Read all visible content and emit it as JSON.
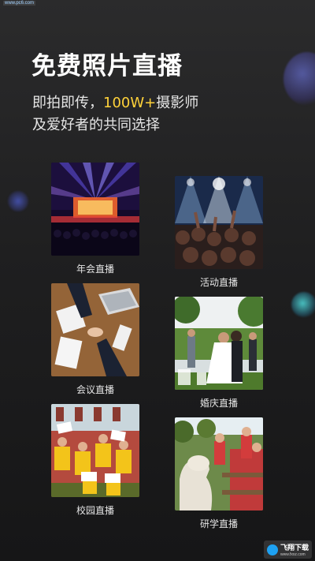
{
  "watermark_top": "www.pc6.com",
  "header": {
    "title": "免费照片直播",
    "subtitle_line1_prefix": "即拍即传，",
    "subtitle_line1_highlight": "100W+",
    "subtitle_line1_suffix": "摄影师",
    "subtitle_line2": "及爱好者的共同选择"
  },
  "categories": [
    {
      "label": "年会直播",
      "image": "concert-stage-lights"
    },
    {
      "label": "活动直播",
      "image": "crowd-concert"
    },
    {
      "label": "会议直播",
      "image": "business-meeting-handshake"
    },
    {
      "label": "婚庆直播",
      "image": "wedding-kiss"
    },
    {
      "label": "校园直播",
      "image": "kids-yellow-shirts"
    },
    {
      "label": "研学直播",
      "image": "kids-feeding-alpaca"
    }
  ],
  "watermark_bottom": {
    "brand": "飞翔下载",
    "url": "www.fxxz.com"
  },
  "colors": {
    "highlight": "#ffd23a",
    "background": "#1f1f20"
  }
}
